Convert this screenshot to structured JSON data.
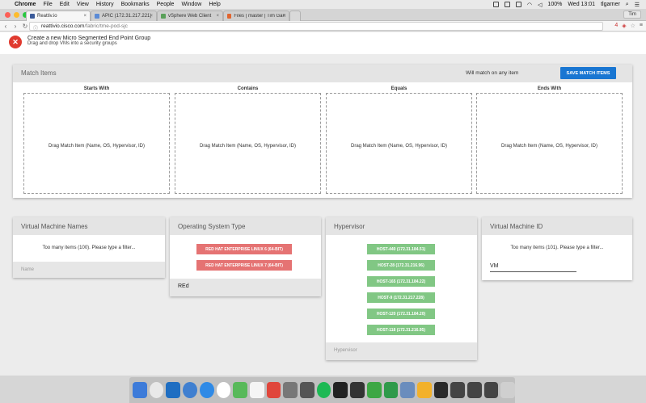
{
  "menubar": {
    "apple": "",
    "items": [
      "Chrome",
      "File",
      "Edit",
      "View",
      "History",
      "Bookmarks",
      "People",
      "Window",
      "Help"
    ],
    "battery": "100%",
    "clock": "Wed 13:01",
    "user": "tlgarner"
  },
  "browser": {
    "tabs": [
      {
        "label": "Reattiv.io",
        "color": "#3b5b9a"
      },
      {
        "label": "APIC (172.31.217.221)",
        "color": "#5b8bd6"
      },
      {
        "label": "vSphere Web Client",
        "color": "#5aa05a"
      },
      {
        "label": "Files | master | Tim Garner",
        "color": "#e1652f"
      }
    ],
    "profile": "Tim",
    "url_host": "reattivio.cisco.com",
    "url_path": "/fabric/tme-pod-sjc"
  },
  "header": {
    "title": "Create a new Micro Segmented End Point Group",
    "subtitle": "Drag and drop VMs into a security groups"
  },
  "match_items": {
    "title": "Match Items",
    "info": "Will match on any item",
    "save_label": "SAVE MATCH ITEMS",
    "zones": [
      {
        "label": "Starts With",
        "message": "Drag Match Item (Name, OS, Hypervisor, ID)"
      },
      {
        "label": "Contains",
        "message": "Drag Match Item (Name, OS, Hypervisor, ID)"
      },
      {
        "label": "Equals",
        "message": "Drag Match Item (Name, OS, Hypervisor, ID)"
      },
      {
        "label": "Ends With",
        "message": "Drag Match Item (Name, OS, Hypervisor, ID)"
      }
    ]
  },
  "vm_names": {
    "title": "Virtual Machine Names",
    "message": "Too many items (100). Please type a filter...",
    "placeholder": "Name"
  },
  "os_type": {
    "title": "Operating System Type",
    "items": [
      "RED HAT ENTERPRISE LINUX 6 (64-BIT)",
      "RED HAT ENTERPRISE LINUX 7 (64-BIT)"
    ],
    "filter_value": "REd"
  },
  "hypervisor": {
    "title": "Hypervisor",
    "items": [
      "HOST-440 (172.31.184.51)",
      "HOST-28 (172.31.216.96)",
      "HOST-165 (172.31.184.22)",
      "HOST-9 (172.31.217.228)",
      "HOST-120 (172.31.184.20)",
      "HOST-118 (172.31.216.95)"
    ],
    "placeholder": "Hypervisor"
  },
  "vm_id": {
    "title": "Virtual Machine ID",
    "message": "Too many items (101). Please type a filter...",
    "filter_value": "VM"
  },
  "colors": {
    "save_button": "#1976d2",
    "close_button": "#e03a2f",
    "os_chip": "#e57373",
    "host_chip": "#81c784"
  }
}
